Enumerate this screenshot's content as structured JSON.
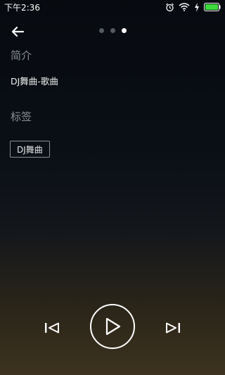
{
  "status_bar": {
    "time": "下午2:36"
  },
  "intro": {
    "title": "简介",
    "text": "DJ舞曲-歌曲"
  },
  "tags": {
    "title": "标签",
    "items": [
      "DJ舞曲"
    ]
  },
  "pager": {
    "count": 3,
    "active_index": 2
  },
  "colors": {
    "accent": "#ffffff",
    "muted": "#8a8f95",
    "battery_charging": "#3ddc3d"
  },
  "icons": [
    "back-arrow-icon",
    "previous-track-icon",
    "play-icon",
    "next-track-icon",
    "alarm-icon",
    "wifi-icon",
    "signal-icon",
    "battery-icon"
  ]
}
